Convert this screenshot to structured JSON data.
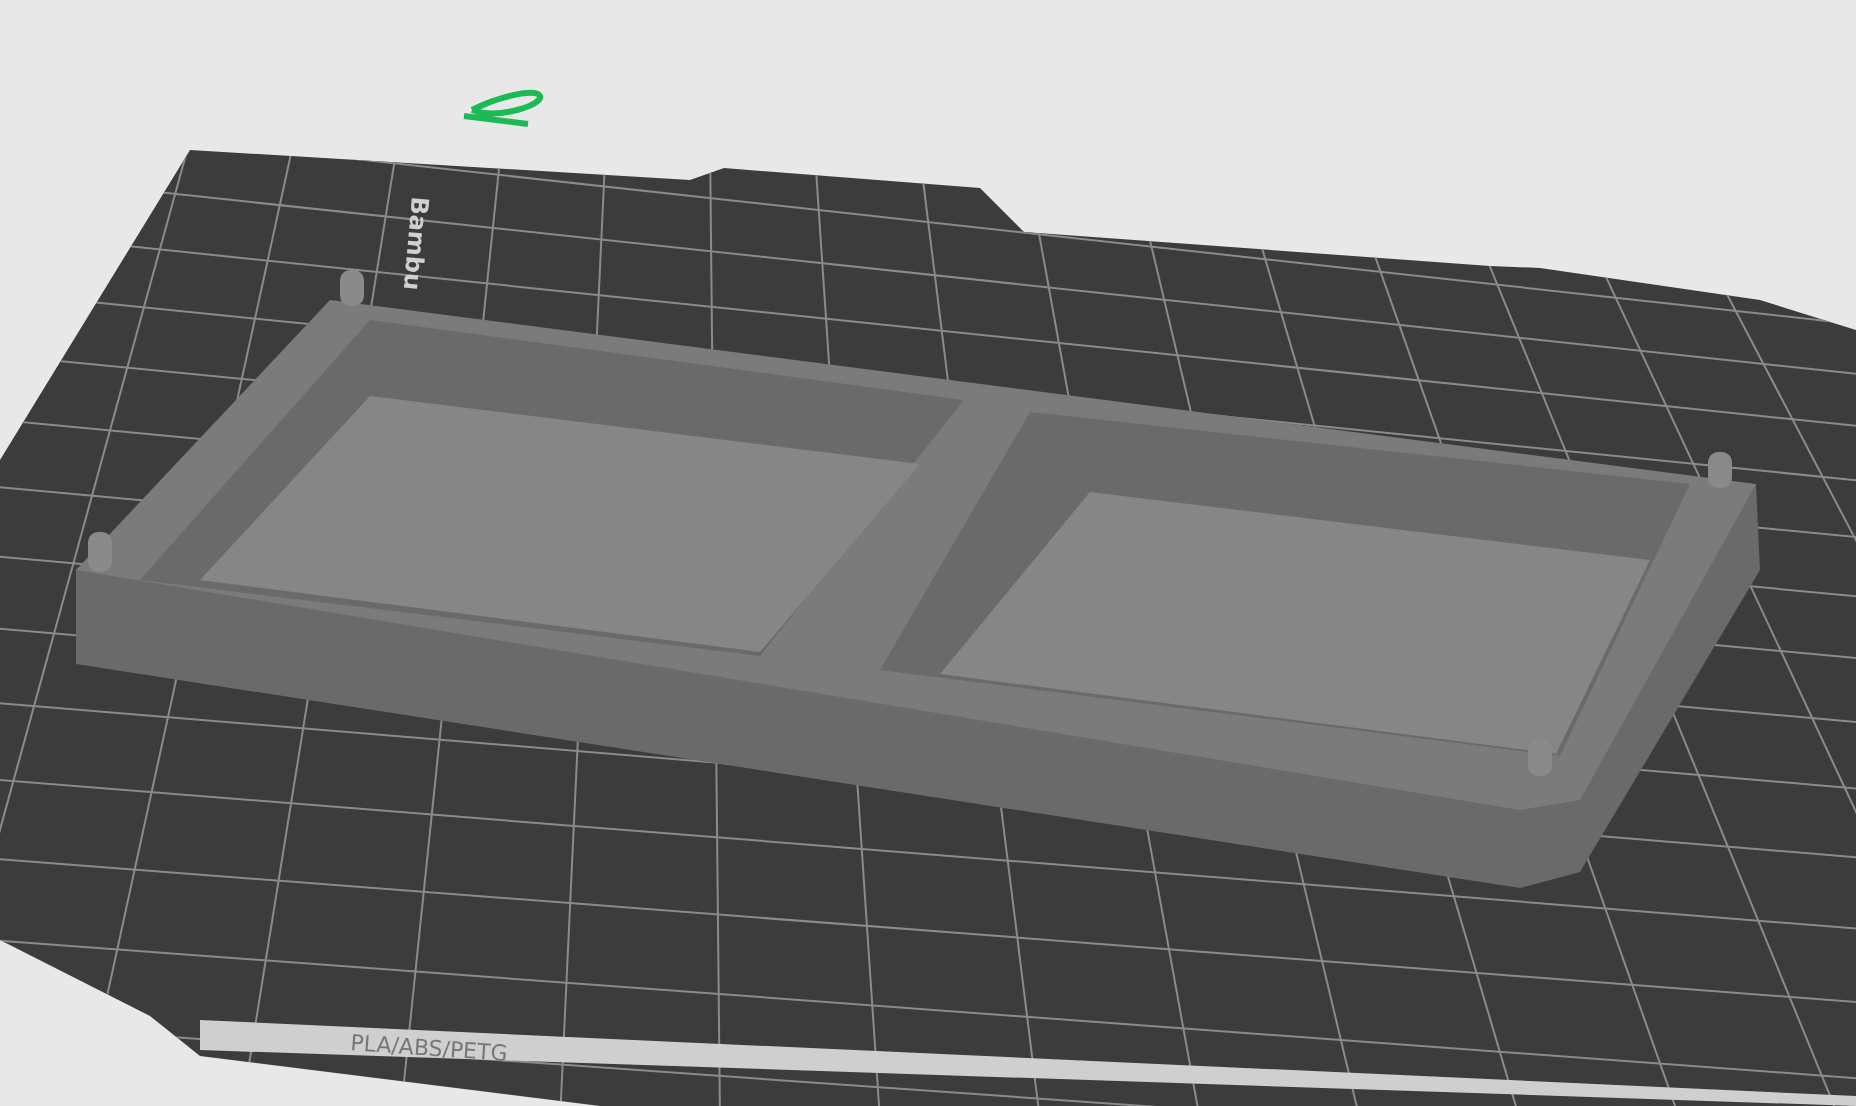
{
  "scene": {
    "plate_logo": "Bambu",
    "plate_label": "PLA/ABS/PETG"
  }
}
